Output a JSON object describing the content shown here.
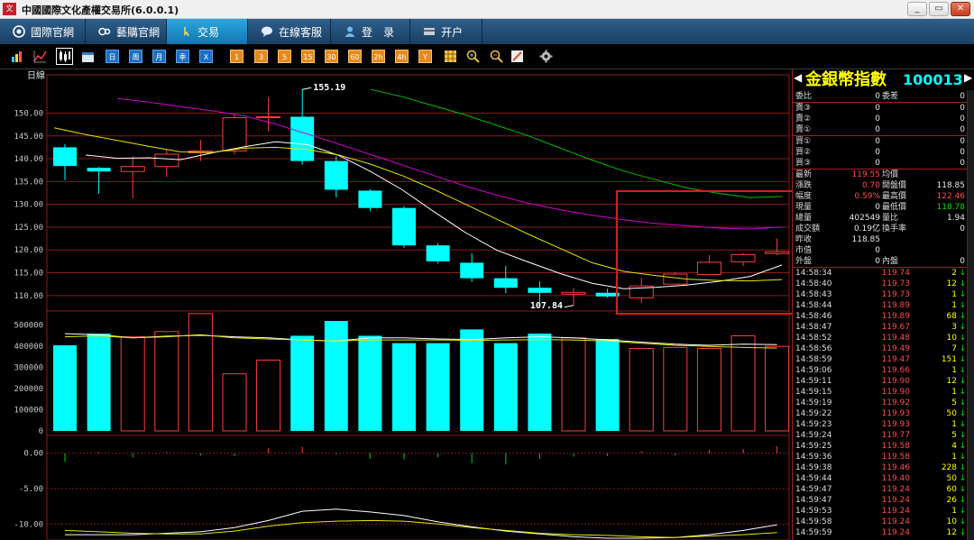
{
  "window": {
    "title": "中國國際文化產權交易所(6.0.0.1)",
    "logo_text": "文"
  },
  "nav": {
    "tabs": [
      {
        "label": "國際官網",
        "icon": "swirl-logo-icon"
      },
      {
        "label": "藝購官網",
        "icon": "link-logo-icon"
      },
      {
        "label": "交易",
        "icon": "cursor-icon"
      },
      {
        "label": "在線客服",
        "icon": "chat-icon"
      },
      {
        "label": "登　录",
        "icon": "person-icon"
      },
      {
        "label": "开户",
        "icon": "card-icon"
      }
    ],
    "active_index": 2
  },
  "toolbar": {
    "icons": [
      "bar-chart-icon",
      "line-chart-icon",
      "candlestick-icon",
      "calendar-icon"
    ],
    "period_buttons": [
      "日",
      "周",
      "月",
      "季",
      "X"
    ],
    "minute_buttons": [
      "1",
      "3",
      "5",
      "15",
      "30",
      "60",
      "2h",
      "4h",
      "Y"
    ],
    "tool_icons": [
      "grid-icon",
      "zoom-in-icon",
      "zoom-out-icon",
      "draw-icon"
    ],
    "settings_icon": "gear-icon"
  },
  "chart": {
    "period_label": "日線",
    "price_ticks": [
      "150.00",
      "145.00",
      "140.00",
      "135.00",
      "130.00",
      "125.00",
      "120.00",
      "115.00",
      "110.00"
    ],
    "volume_ticks": [
      "500000",
      "400000",
      "300000",
      "200000",
      "100000",
      "0"
    ],
    "indicator_ticks": [
      "0.00",
      "-5.00",
      "-10.00"
    ],
    "max_label": "155.19",
    "min_label": "107.84"
  },
  "chart_data": {
    "type": "candlestick",
    "ylim": [
      107,
      158
    ],
    "candles": [
      {
        "o": 142.5,
        "h": 143.2,
        "l": 135.3,
        "c": 138.4,
        "dir": "down"
      },
      {
        "o": 138.0,
        "h": 138.2,
        "l": 132.3,
        "c": 137.2,
        "dir": "down"
      },
      {
        "o": 137.2,
        "h": 140.5,
        "l": 131.3,
        "c": 138.3,
        "dir": "up"
      },
      {
        "o": 138.3,
        "h": 142.0,
        "l": 136.0,
        "c": 141.0,
        "dir": "up"
      },
      {
        "o": 141.3,
        "h": 144.1,
        "l": 139.5,
        "c": 141.7,
        "dir": "up"
      },
      {
        "o": 141.7,
        "h": 149.7,
        "l": 141.0,
        "c": 149.0,
        "dir": "up"
      },
      {
        "o": 149.0,
        "h": 153.5,
        "l": 146.0,
        "c": 149.2,
        "dir": "up"
      },
      {
        "o": 149.2,
        "h": 155.19,
        "l": 138.7,
        "c": 139.5,
        "dir": "down"
      },
      {
        "o": 139.5,
        "h": 140.5,
        "l": 131.5,
        "c": 133.2,
        "dir": "down"
      },
      {
        "o": 133.0,
        "h": 133.3,
        "l": 128.5,
        "c": 129.2,
        "dir": "down"
      },
      {
        "o": 129.2,
        "h": 129.6,
        "l": 120.5,
        "c": 121.0,
        "dir": "down"
      },
      {
        "o": 121.0,
        "h": 121.5,
        "l": 117.0,
        "c": 117.5,
        "dir": "down"
      },
      {
        "o": 117.2,
        "h": 119.3,
        "l": 113.0,
        "c": 113.8,
        "dir": "down"
      },
      {
        "o": 113.8,
        "h": 116.5,
        "l": 110.5,
        "c": 111.7,
        "dir": "down"
      },
      {
        "o": 111.7,
        "h": 113.1,
        "l": 108.5,
        "c": 110.6,
        "dir": "down"
      },
      {
        "o": 110.3,
        "h": 111.7,
        "l": 107.84,
        "c": 110.7,
        "dir": "up"
      },
      {
        "o": 110.6,
        "h": 111.5,
        "l": 109.5,
        "c": 109.8,
        "dir": "down"
      },
      {
        "o": 109.5,
        "h": 113.8,
        "l": 108.3,
        "c": 112.1,
        "dir": "up"
      },
      {
        "o": 112.5,
        "h": 115.2,
        "l": 112.5,
        "c": 114.7,
        "dir": "up"
      },
      {
        "o": 114.6,
        "h": 118.9,
        "l": 114.6,
        "c": 117.3,
        "dir": "up"
      },
      {
        "o": 117.4,
        "h": 119.3,
        "l": 116.5,
        "c": 119.0,
        "dir": "up"
      },
      {
        "o": 119.2,
        "h": 122.5,
        "l": 118.85,
        "c": 119.6,
        "dir": "up"
      }
    ],
    "ma_lines": [
      {
        "name": "ma-white",
        "color": "#ffffff",
        "values": [
          null,
          140.8,
          140.1,
          140.2,
          139.8,
          141.3,
          142.6,
          143.7,
          143.1,
          140.7,
          137.2,
          133.2,
          128.4,
          123.8,
          119.9,
          117.3,
          114.8,
          112.7,
          111.5,
          111.8,
          112.3,
          113.1,
          114.2,
          116.7
        ]
      },
      {
        "name": "ma-yellow",
        "color": "#e6e600",
        "values": [
          146.8,
          145.3,
          144.0,
          142.7,
          141.5,
          141.4,
          142.3,
          142.5,
          142.0,
          140.8,
          138.8,
          136.3,
          133.3,
          130.0,
          126.7,
          123.4,
          120.3,
          117.2,
          115.3,
          114.4,
          113.6,
          113.3,
          113.2,
          113.5
        ]
      },
      {
        "name": "ma-magenta",
        "color": "#d000d0",
        "values": [
          null,
          null,
          153.2,
          152.4,
          151.4,
          150.5,
          149.4,
          147.6,
          145.4,
          143.2,
          140.9,
          138.6,
          136.3,
          134.0,
          132.0,
          130.2,
          128.8,
          127.6,
          126.6,
          125.8,
          125.3,
          124.8,
          124.6,
          125.0
        ]
      },
      {
        "name": "ma-green",
        "color": "#00c000",
        "values": [
          null,
          null,
          null,
          null,
          null,
          null,
          null,
          null,
          null,
          null,
          155.2,
          153.6,
          151.6,
          149.6,
          147.3,
          145.0,
          142.3,
          139.7,
          137.3,
          135.4,
          133.6,
          132.4,
          131.5,
          131.7
        ]
      }
    ],
    "volume": {
      "ylim": [
        0,
        550000
      ],
      "values": [
        405000,
        460000,
        445000,
        470000,
        555000,
        270000,
        335000,
        450000,
        520000,
        450000,
        415000,
        415000,
        480000,
        415000,
        460000,
        440000,
        435000,
        390000,
        395000,
        390000,
        450000,
        400000
      ],
      "ma_white": [
        460000,
        455000,
        440000,
        448000,
        452000,
        445000,
        440000,
        430000,
        425000,
        440000,
        440000,
        435000,
        432000,
        440000,
        445000,
        440000,
        430000,
        420000,
        410000,
        405000,
        410000,
        408000
      ],
      "ma_yellow": [
        445000,
        450000,
        440000,
        445000,
        455000,
        440000,
        435000,
        430000,
        425000,
        430000,
        430000,
        430000,
        428000,
        430000,
        432000,
        430000,
        425000,
        415000,
        405000,
        400000,
        395000,
        392000
      ]
    },
    "indicator": {
      "ylim": [
        -12,
        2
      ],
      "bars": [
        -1.2,
        0.2,
        -0.6,
        0.15,
        -0.3,
        -0.4,
        0.7,
        0.9,
        -0.2,
        -0.8,
        -0.9,
        -0.6,
        -1.4,
        -1.6,
        -0.8,
        -0.5,
        -0.4,
        0.3,
        -0.3,
        0.5,
        0.6,
        1.0
      ],
      "line_white": [
        -11.5,
        -11.5,
        -11.5,
        -11.3,
        -11.1,
        -10.5,
        -9.5,
        -8.2,
        -7.9,
        -8.3,
        -8.8,
        -9.7,
        -10.4,
        -11.0,
        -11.4,
        -11.8,
        -12.0,
        -12.0,
        -11.9,
        -11.5,
        -10.9,
        -10.1
      ],
      "line_yellow": [
        -10.9,
        -11.1,
        -11.3,
        -11.4,
        -11.4,
        -11.0,
        -10.3,
        -9.8,
        -9.6,
        -9.5,
        -9.6,
        -10.0,
        -10.5,
        -10.9,
        -11.3,
        -11.5,
        -11.6,
        -11.8,
        -11.9,
        -11.7,
        -11.5,
        -11.2
      ]
    }
  },
  "quote": {
    "name": "金銀幣指數",
    "code": "100013",
    "book_top": [
      {
        "label": "委比",
        "value": "0",
        "label2": "委差",
        "value2": "0"
      }
    ],
    "asks": [
      {
        "label": "賣③",
        "price": "0",
        "vol": "0"
      },
      {
        "label": "賣②",
        "price": "0",
        "vol": "0"
      },
      {
        "label": "賣①",
        "price": "0",
        "vol": "0"
      }
    ],
    "bids": [
      {
        "label": "買①",
        "price": "0",
        "vol": "0"
      },
      {
        "label": "買②",
        "price": "0",
        "vol": "0"
      },
      {
        "label": "買③",
        "price": "0",
        "vol": "0"
      }
    ],
    "stats": [
      {
        "label": "最新",
        "value": "119.55",
        "vcolor": "red",
        "label2": "均價",
        "value2": "",
        "v2color": "white"
      },
      {
        "label": "漲跌",
        "value": "0.70",
        "vcolor": "red",
        "label2": "開盤價",
        "value2": "118.85",
        "v2color": "white"
      },
      {
        "label": "幅度",
        "value": "0.59%",
        "vcolor": "red",
        "label2": "最高價",
        "value2": "122.46",
        "v2color": "red"
      },
      {
        "label": "現量",
        "value": "0",
        "vcolor": "white",
        "label2": "最低價",
        "value2": "118.78",
        "v2color": "green"
      },
      {
        "label": "總量",
        "value": "402549",
        "vcolor": "white",
        "label2": "量比",
        "value2": "1.94",
        "v2color": "white"
      },
      {
        "label": "成交額",
        "value": "0.19亿",
        "vcolor": "white",
        "label2": "換手率",
        "value2": "0",
        "v2color": "white"
      },
      {
        "label": "昨收",
        "value": "118.85",
        "vcolor": "white",
        "label2": "",
        "value2": "",
        "v2color": "white"
      },
      {
        "label": "市值",
        "value": "0",
        "vcolor": "white",
        "label2": "",
        "value2": "",
        "v2color": "white"
      },
      {
        "label": "外盤",
        "value": "0",
        "vcolor": "white",
        "label2": "內盤",
        "value2": "0",
        "v2color": "white"
      }
    ],
    "ticks": [
      {
        "time": "14:58:34",
        "price": "119.74",
        "vol": "2"
      },
      {
        "time": "14:58:40",
        "price": "119.73",
        "vol": "12"
      },
      {
        "time": "14:58:43",
        "price": "119.73",
        "vol": "1"
      },
      {
        "time": "14:58:44",
        "price": "119.89",
        "vol": "1"
      },
      {
        "time": "14:58:46",
        "price": "119.89",
        "vol": "68"
      },
      {
        "time": "14:58:47",
        "price": "119.67",
        "vol": "3"
      },
      {
        "time": "14:58:52",
        "price": "119.48",
        "vol": "10"
      },
      {
        "time": "14:58:56",
        "price": "119.49",
        "vol": "7"
      },
      {
        "time": "14:58:59",
        "price": "119.47",
        "vol": "151"
      },
      {
        "time": "14:59:06",
        "price": "119.66",
        "vol": "1"
      },
      {
        "time": "14:59:11",
        "price": "119.90",
        "vol": "12"
      },
      {
        "time": "14:59:15",
        "price": "119.90",
        "vol": "1"
      },
      {
        "time": "14:59:19",
        "price": "119.92",
        "vol": "5"
      },
      {
        "time": "14:59:22",
        "price": "119.93",
        "vol": "50"
      },
      {
        "time": "14:59:23",
        "price": "119.93",
        "vol": "1"
      },
      {
        "time": "14:59:24",
        "price": "119.77",
        "vol": "5"
      },
      {
        "time": "14:59:25",
        "price": "119.58",
        "vol": "4"
      },
      {
        "time": "14:59:36",
        "price": "119.58",
        "vol": "1"
      },
      {
        "time": "14:59:38",
        "price": "119.46",
        "vol": "228"
      },
      {
        "time": "14:59:44",
        "price": "119.40",
        "vol": "50"
      },
      {
        "time": "14:59:47",
        "price": "119.24",
        "vol": "60"
      },
      {
        "time": "14:59:47",
        "price": "119.24",
        "vol": "26"
      },
      {
        "time": "14:59:53",
        "price": "119.24",
        "vol": "1"
      },
      {
        "time": "14:59:58",
        "price": "119.24",
        "vol": "10"
      },
      {
        "time": "14:59:59",
        "price": "119.24",
        "vol": "12"
      }
    ],
    "tick_arrow": "↓"
  },
  "colors": {
    "up": "#ff3c3c",
    "down": "#00ffff",
    "grid": "#8b1a1a",
    "axis_text": "#c8c8c8"
  }
}
